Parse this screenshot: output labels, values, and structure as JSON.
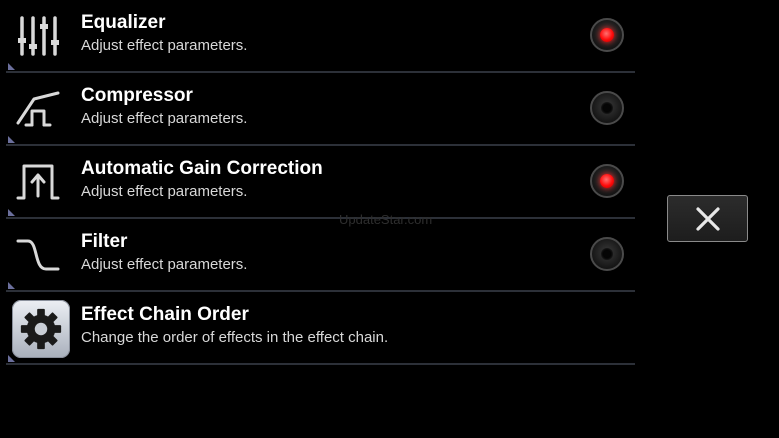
{
  "effects": [
    {
      "title": "Equalizer",
      "description": "Adjust effect parameters.",
      "icon": "equalizer-icon",
      "enabled": true
    },
    {
      "title": "Compressor",
      "description": "Adjust effect parameters.",
      "icon": "compressor-icon",
      "enabled": false
    },
    {
      "title": "Automatic Gain Correction",
      "description": "Adjust effect parameters.",
      "icon": "gain-correction-icon",
      "enabled": true
    },
    {
      "title": "Filter",
      "description": "Adjust effect parameters.",
      "icon": "filter-icon",
      "enabled": false
    }
  ],
  "chain_order": {
    "title": "Effect Chain Order",
    "description": "Change the order of effects in the effect chain.",
    "icon": "gear-icon"
  },
  "watermark": "UpdateStar.com",
  "close_icon": "close-icon",
  "colors": {
    "background": "#000000",
    "led_on": "#ff0a0a",
    "divider": "#2c3038"
  }
}
